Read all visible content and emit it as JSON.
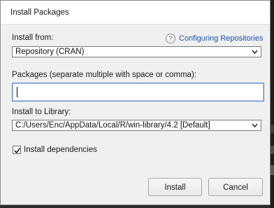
{
  "dialog": {
    "title": "Install Packages"
  },
  "install_from": {
    "label": "Install from:",
    "help_link": "Configuring Repositories",
    "selected": "Repository (CRAN)"
  },
  "packages": {
    "label": "Packages (separate multiple with space or comma):",
    "value": ""
  },
  "library": {
    "label": "Install to Library:",
    "selected": "C:/Users/Enc/AppData/Local/R/win-library/4.2 [Default]"
  },
  "dependencies": {
    "label": "Install dependencies",
    "checked": true
  },
  "buttons": {
    "install": "Install",
    "cancel": "Cancel"
  }
}
